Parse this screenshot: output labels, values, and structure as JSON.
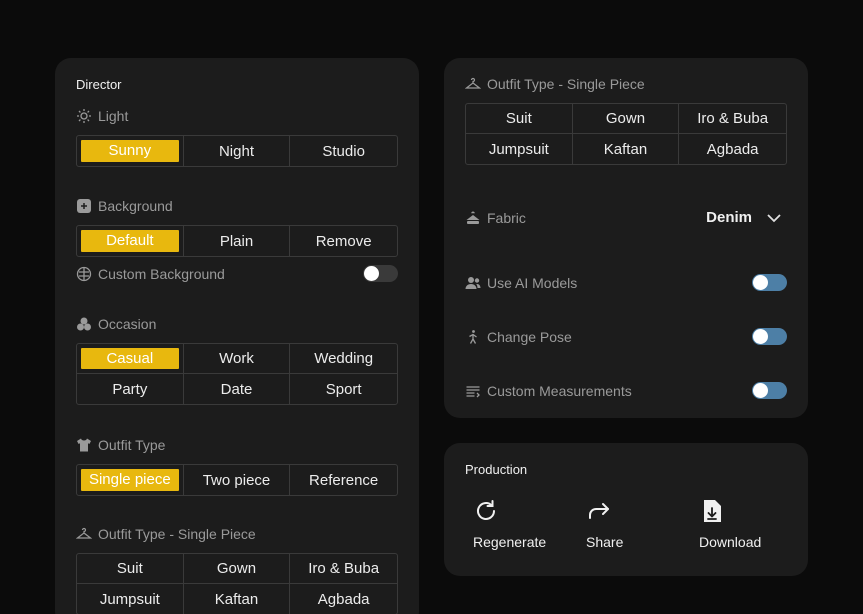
{
  "director": {
    "title": "Director",
    "light": {
      "label": "Light",
      "options": [
        "Sunny",
        "Night",
        "Studio"
      ],
      "selected": "Sunny"
    },
    "background": {
      "label": "Background",
      "options": [
        "Default",
        "Plain",
        "Remove"
      ],
      "selected": "Default",
      "custom_label": "Custom Background",
      "custom_enabled": false
    },
    "occasion": {
      "label": "Occasion",
      "options": [
        "Casual",
        "Work",
        "Wedding",
        "Party",
        "Date",
        "Sport"
      ],
      "selected": "Casual"
    },
    "outfit_type": {
      "label": "Outfit Type",
      "options": [
        "Single piece",
        "Two piece",
        "Reference"
      ],
      "selected": "Single piece"
    },
    "single_piece": {
      "label": "Outfit Type - Single Piece",
      "options": [
        "Suit",
        "Gown",
        "Iro & Buba",
        "Jumpsuit",
        "Kaftan",
        "Agbada"
      ]
    }
  },
  "outfit": {
    "label": "Outfit Type - Single Piece",
    "options": [
      "Suit",
      "Gown",
      "Iro & Buba",
      "Jumpsuit",
      "Kaftan",
      "Agbada"
    ],
    "fabric_label": "Fabric",
    "fabric_value": "Denim",
    "ai_models_label": "Use AI Models",
    "ai_models_enabled": false,
    "change_pose_label": "Change Pose",
    "change_pose_enabled": false,
    "measurements_label": "Custom Measurements",
    "measurements_enabled": false
  },
  "production": {
    "title": "Production",
    "regenerate_label": "Regenerate",
    "share_label": "Share",
    "download_label": "Download"
  },
  "colors": {
    "accent": "#e8b80e",
    "toggle_on_track": "#4d7fa6",
    "panel": "#1c1c1c",
    "background": "#0b0b0b"
  }
}
